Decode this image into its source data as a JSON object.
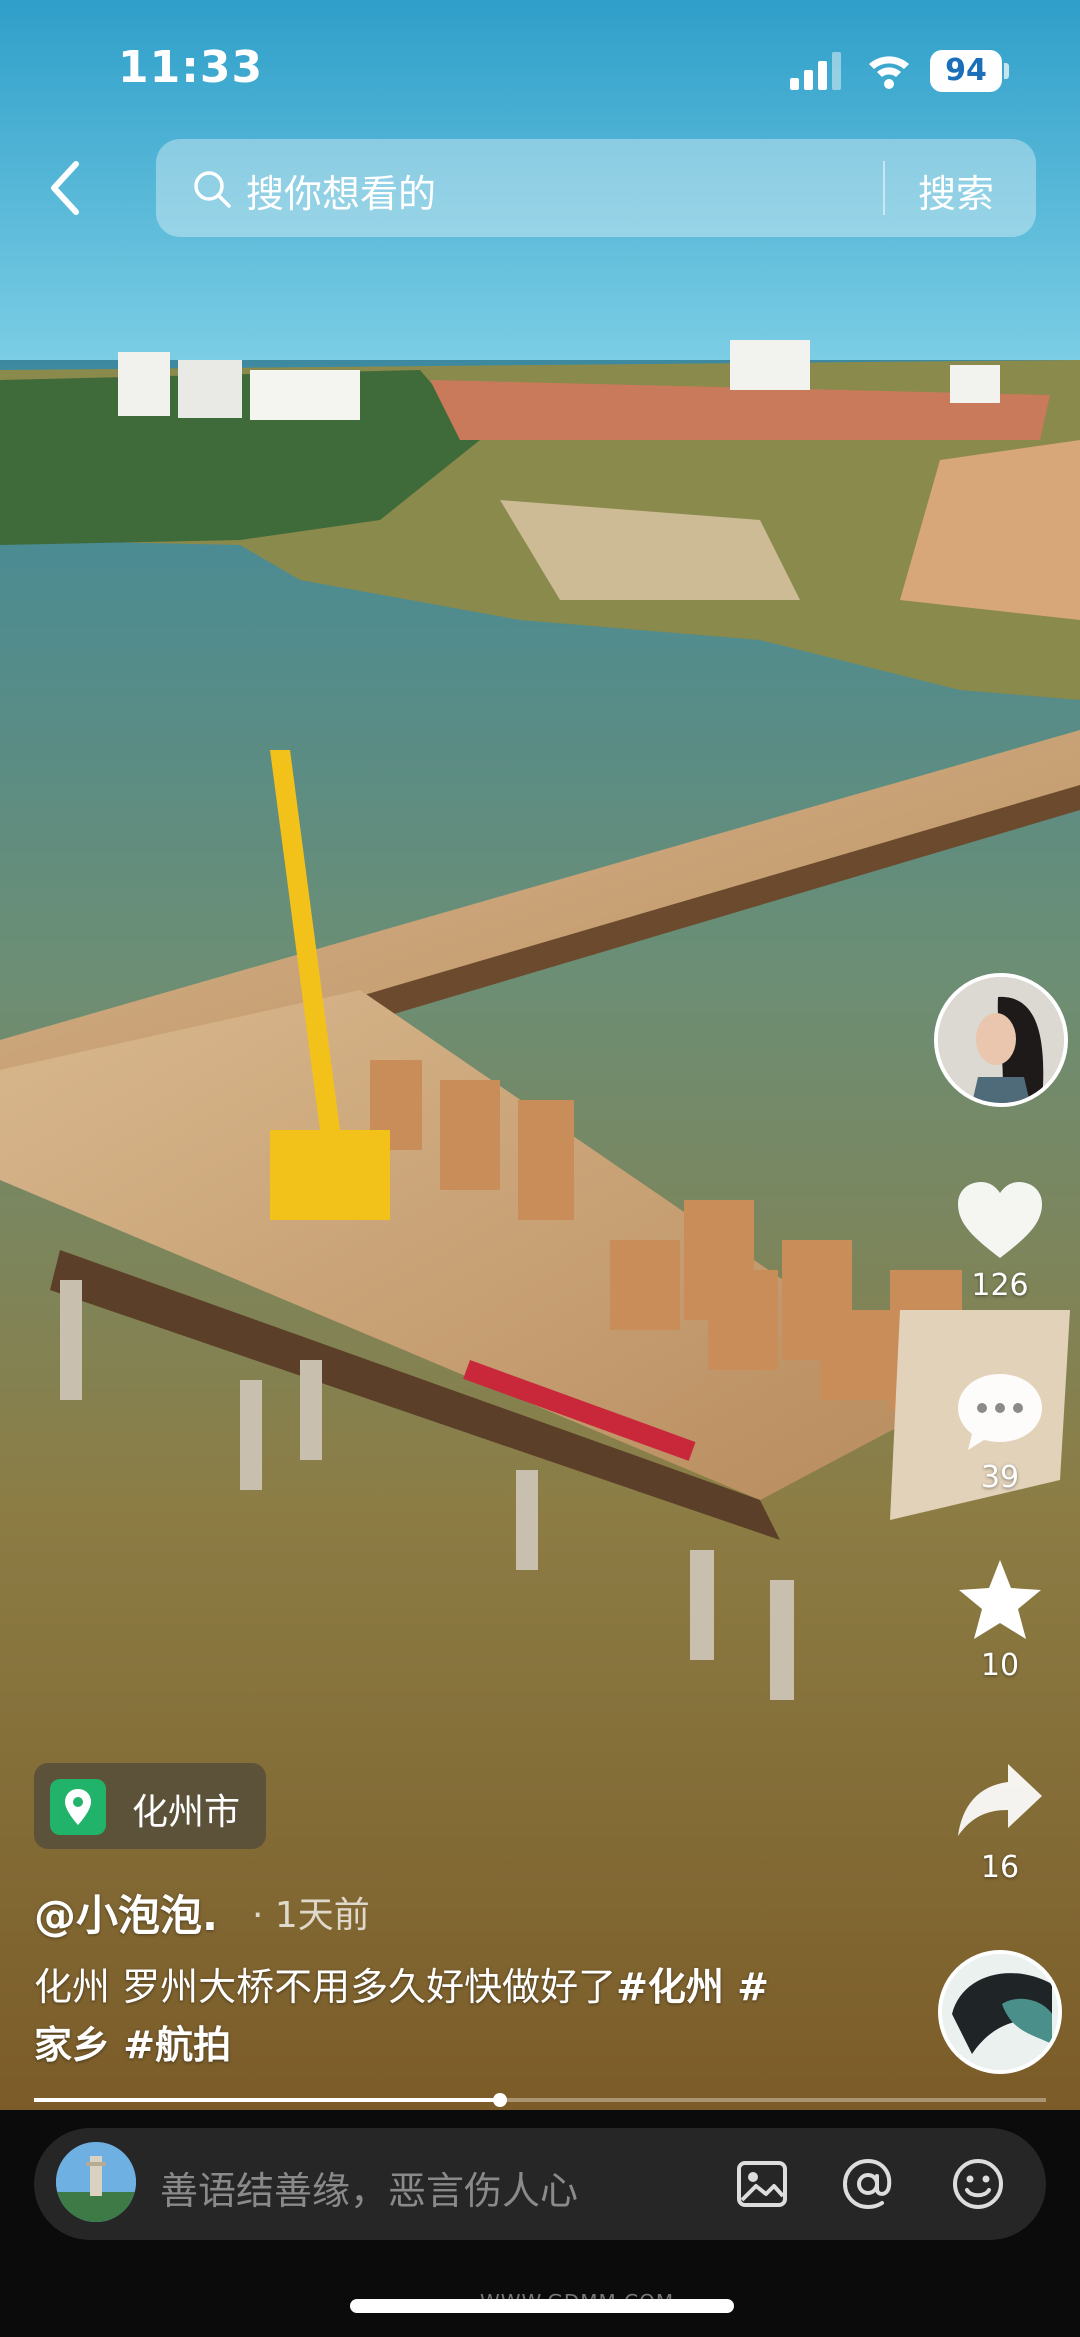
{
  "status_bar": {
    "time": "11:33",
    "battery": "94"
  },
  "search": {
    "placeholder": "搜你想看的",
    "button": "搜索"
  },
  "actions": {
    "likes": "126",
    "comments": "39",
    "favorites": "10",
    "shares": "16"
  },
  "post": {
    "location": "化州市",
    "author": "@小泡泡.",
    "time_ago": "· 1天前",
    "caption_line1": "化州 罗州大桥不用多久好快做好了",
    "tag1": "#化州 #",
    "caption_line2_tag": "家乡 #航拍",
    "progress": 0.46
  },
  "comment_bar": {
    "placeholder": "善语结善缘，恶言伤人心"
  },
  "watermark": "WWW.GDMM.COM",
  "icons": [
    "back-icon",
    "search-icon",
    "heart-icon",
    "comment-icon",
    "star-icon",
    "share-icon",
    "image-icon",
    "at-icon",
    "emoji-icon",
    "location-pin-icon"
  ]
}
